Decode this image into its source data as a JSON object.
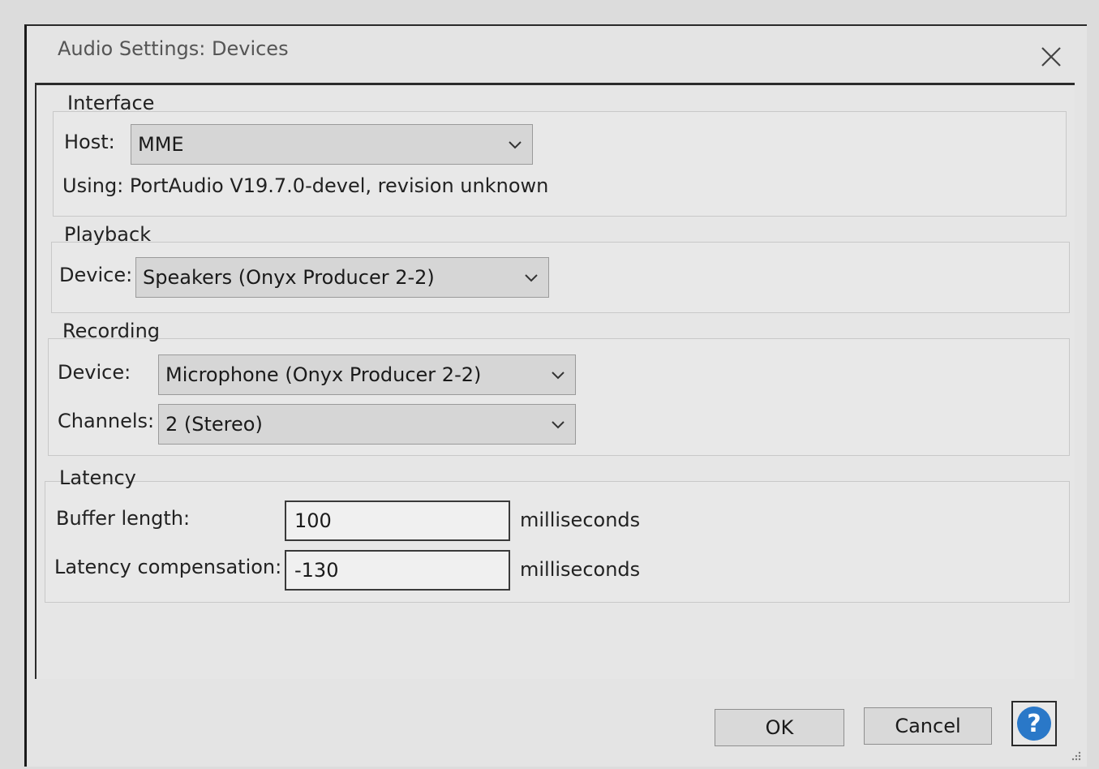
{
  "window": {
    "title": "Audio Settings: Devices",
    "close_icon": "close-icon"
  },
  "interface": {
    "group_label": "Interface",
    "host_label": "Host:",
    "host_value": "MME",
    "using_text": "Using: PortAudio V19.7.0-devel, revision unknown"
  },
  "playback": {
    "group_label": "Playback",
    "device_label": "Device:",
    "device_value": "Speakers (Onyx Producer 2-2)"
  },
  "recording": {
    "group_label": "Recording",
    "device_label": "Device:",
    "device_value": "Microphone (Onyx Producer 2-2)",
    "channels_label": "Channels:",
    "channels_value": "2 (Stereo)"
  },
  "latency": {
    "group_label": "Latency",
    "buffer_label": "Buffer length:",
    "buffer_value": "100",
    "buffer_unit": "milliseconds",
    "compensation_label": "Latency compensation:",
    "compensation_value": "-130",
    "compensation_unit": "milliseconds"
  },
  "footer": {
    "ok_label": "OK",
    "cancel_label": "Cancel",
    "help_label": "?"
  },
  "colors": {
    "help_blue": "#2a78c8"
  }
}
